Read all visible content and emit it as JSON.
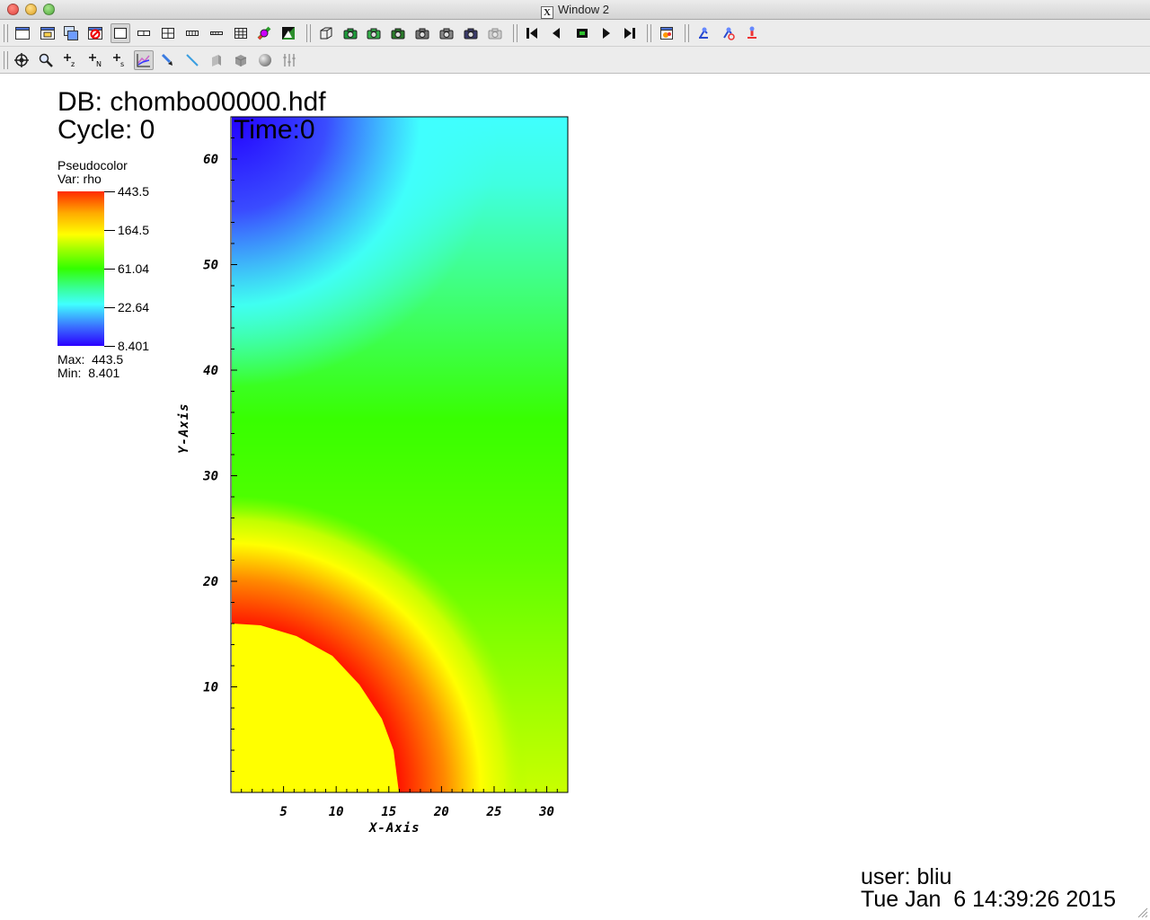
{
  "window": {
    "title": "Window 2",
    "title_badge": "X"
  },
  "toolbar_main": {
    "icons": [
      "new-window-icon",
      "clone-window-icon",
      "copy-window-icon",
      "delete-window-icon",
      "layout-1x1-icon",
      "layout-1x2-icon",
      "layout-2x2-icon",
      "layout-2x4-icon",
      "layout-3x3-icon",
      "layout-4x4-icon",
      "lock-view-icon",
      "invert-background-icon",
      "toggle-3d-mode-icon",
      "draw-plots-icon",
      "clear-plots-icon",
      "save-window-icon",
      "save-movie-icon",
      "record-icon",
      "snapshot-icon",
      "camera-disabled-icon",
      "rewind-icon",
      "reverse-step-icon",
      "stop-icon",
      "play-icon",
      "step-forward-icon",
      "spin-mode-icon",
      "lighting-icon",
      "view-icon",
      "reset-view-icon"
    ],
    "pressed": "layout-1x1-icon"
  },
  "toolbar_mode": {
    "icons": [
      "navigate-icon",
      "zoom-icon",
      "zone-pick-icon",
      "node-pick-icon",
      "spreadsheet-pick-icon",
      "lineout-icon",
      "point-tool-icon",
      "line-tool-icon",
      "plane-tool-icon",
      "box-tool-icon",
      "sphere-tool-icon",
      "axis-restrict-tool-icon"
    ],
    "pressed": "lineout-icon"
  },
  "annotations": {
    "db": "DB: chombo00000.hdf",
    "cycle": "Cycle: 0",
    "time": "Time:0",
    "user": "user: bliu",
    "date": "Tue Jan  6 14:39:26 2015"
  },
  "legend": {
    "title": "Pseudocolor",
    "var": "Var: rho",
    "labels": [
      "443.5",
      "164.5",
      "61.04",
      "22.64",
      "8.401"
    ],
    "max": "Max:  443.5",
    "min": "Min:  8.401",
    "colors": [
      "#2a00ff",
      "#40ffff",
      "#33ff00",
      "#ffff00",
      "#ff2a00"
    ]
  },
  "chart_data": {
    "type": "heatmap",
    "title": "",
    "xlabel": "X-Axis",
    "ylabel": "Y-Axis",
    "xlim": [
      0,
      32
    ],
    "ylim": [
      0,
      64
    ],
    "x_ticks": [
      "5",
      "10",
      "15",
      "20",
      "25",
      "30"
    ],
    "y_ticks": [
      "10",
      "20",
      "30",
      "40",
      "50",
      "60"
    ],
    "variable": "rho",
    "value_range": [
      8.401,
      443.5
    ],
    "color_scale": "log"
  }
}
